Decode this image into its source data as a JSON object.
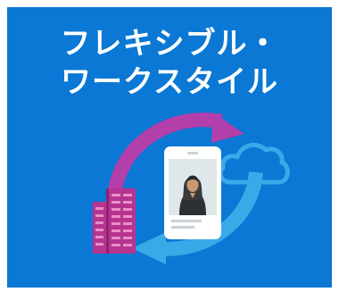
{
  "banner": {
    "title_line1": "フレキシブル・",
    "title_line2": "ワークスタイル",
    "background_color": "#0a78d4"
  },
  "illustration": {
    "icons": [
      "office-building-icon",
      "smartphone-icon",
      "person-icon",
      "cloud-icon",
      "cycle-arrow-icon"
    ],
    "colors": {
      "arrow_purple": "#b33faa",
      "arrow_blue": "#3aa9e8",
      "building": "#b6348f",
      "cloud": "#3aa9e8",
      "phone_screen": "#dfe7ea"
    }
  }
}
